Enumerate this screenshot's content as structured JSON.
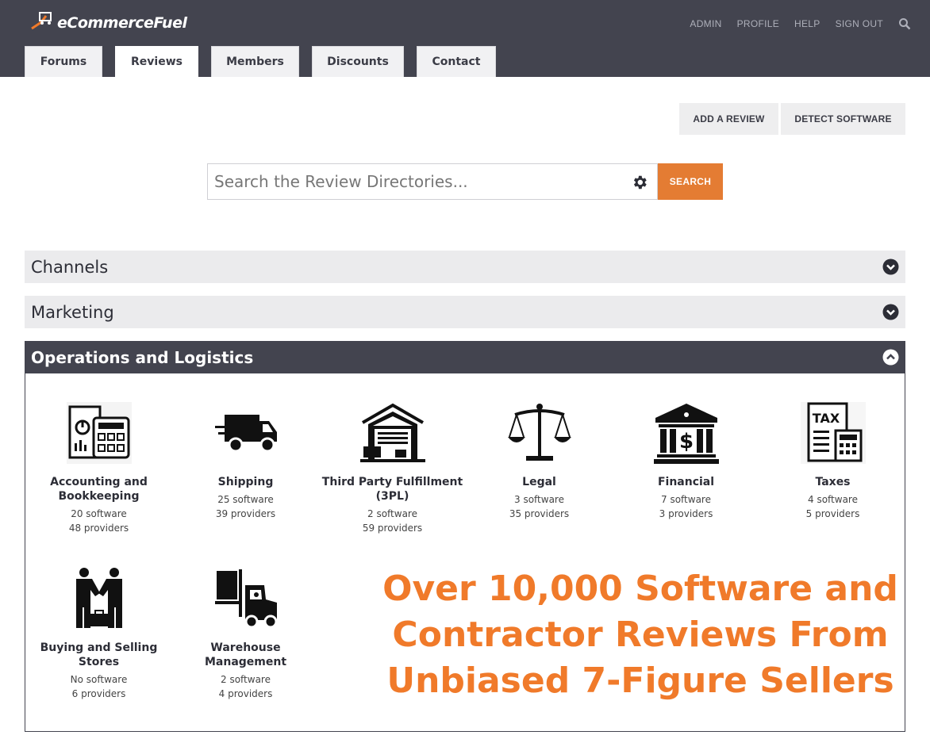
{
  "header": {
    "logo_text": "eCommerceFuel",
    "util_links": [
      "ADMIN",
      "PROFILE",
      "HELP",
      "SIGN OUT"
    ],
    "search_icon": "search-icon"
  },
  "tabs": [
    {
      "label": "Forums",
      "active": false
    },
    {
      "label": "Reviews",
      "active": true
    },
    {
      "label": "Members",
      "active": false
    },
    {
      "label": "Discounts",
      "active": false
    },
    {
      "label": "Contact",
      "active": false
    }
  ],
  "actions": {
    "add_review": "ADD A REVIEW",
    "detect_software": "DETECT SOFTWARE"
  },
  "search": {
    "placeholder": "Search the Review Directories...",
    "value": "",
    "button_label": "SEARCH",
    "settings_icon": "gear-icon"
  },
  "categories": [
    {
      "title": "Channels",
      "expanded": false
    },
    {
      "title": "Marketing",
      "expanded": false
    },
    {
      "title": "Operations and Logistics",
      "expanded": true
    }
  ],
  "operations_items": [
    {
      "name": "Accounting and Bookkeeping",
      "line1": "20 software",
      "line2": "48 providers",
      "icon": "accounting-icon"
    },
    {
      "name": "Shipping",
      "line1": "25 software",
      "line2": "39 providers",
      "icon": "truck-icon"
    },
    {
      "name": "Third Party Fulfillment (3PL)",
      "line1": "2 software",
      "line2": "59 providers",
      "icon": "warehouse-icon"
    },
    {
      "name": "Legal",
      "line1": "3 software",
      "line2": "35 providers",
      "icon": "scales-icon"
    },
    {
      "name": "Financial",
      "line1": "7 software",
      "line2": "3 providers",
      "icon": "bank-icon"
    },
    {
      "name": "Taxes",
      "line1": "4 software",
      "line2": "5 providers",
      "icon": "tax-icon"
    },
    {
      "name": "Buying and Selling Stores",
      "line1": "No software",
      "line2": "6 providers",
      "icon": "handshake-icon"
    },
    {
      "name": "Warehouse Management",
      "line1": "2 software",
      "line2": "4 providers",
      "icon": "forklift-icon"
    }
  ],
  "promo": {
    "line1": "Over 10,000 Software and",
    "line2": "Contractor Reviews From",
    "line3": "Unbiased 7-Figure Sellers"
  },
  "colors": {
    "header_bg": "#43444f",
    "accent": "#e47c33",
    "promo": "#f07a2a"
  }
}
